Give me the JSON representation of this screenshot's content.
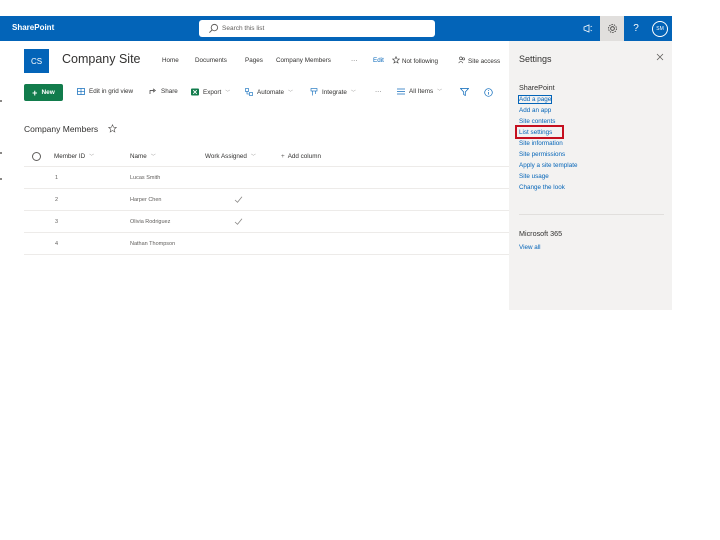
{
  "suitebar": {
    "brand": "SharePoint",
    "search_placeholder": "Search this list",
    "avatar_initials": "SM",
    "help_label": "?"
  },
  "site": {
    "logo_initials": "CS",
    "title": "Company Site",
    "nav": [
      "Home",
      "Documents",
      "Pages",
      "Company Members",
      "···"
    ],
    "edit_label": "Edit",
    "follow_label": "Not following",
    "site_access_label": "Site access"
  },
  "commandbar": {
    "new_label": "New",
    "edit_grid_label": "Edit in grid view",
    "share_label": "Share",
    "export_label": "Export",
    "automate_label": "Automate",
    "integrate_label": "Integrate",
    "more_label": "···",
    "view_label": "All Items"
  },
  "list": {
    "title": "Company Members",
    "columns": [
      "Member ID",
      "Name",
      "Work Assigned",
      "Add column"
    ],
    "rows": [
      {
        "id": "1",
        "name": "Lucas Smith",
        "work_assigned": false
      },
      {
        "id": "2",
        "name": "Harper Chen",
        "work_assigned": true
      },
      {
        "id": "3",
        "name": "Olivia Rodriguez",
        "work_assigned": true
      },
      {
        "id": "4",
        "name": "Nathan Thompson",
        "work_assigned": false
      }
    ]
  },
  "settings_pane": {
    "title": "Settings",
    "sharepoint_heading": "SharePoint",
    "links": [
      "Add a page",
      "Add an app",
      "Site contents",
      "List settings",
      "Site information",
      "Site permissions",
      "Apply a site template",
      "Site usage",
      "Change the look"
    ],
    "highlighted_link": "List settings",
    "m365_heading": "Microsoft 365",
    "m365_link": "View all"
  },
  "colors": {
    "suitebar": "#0364b8",
    "new_button": "#127c4c",
    "link": "#0364b8",
    "highlight_box": "#c50f1f",
    "pane_bg": "#f3f2f1"
  }
}
